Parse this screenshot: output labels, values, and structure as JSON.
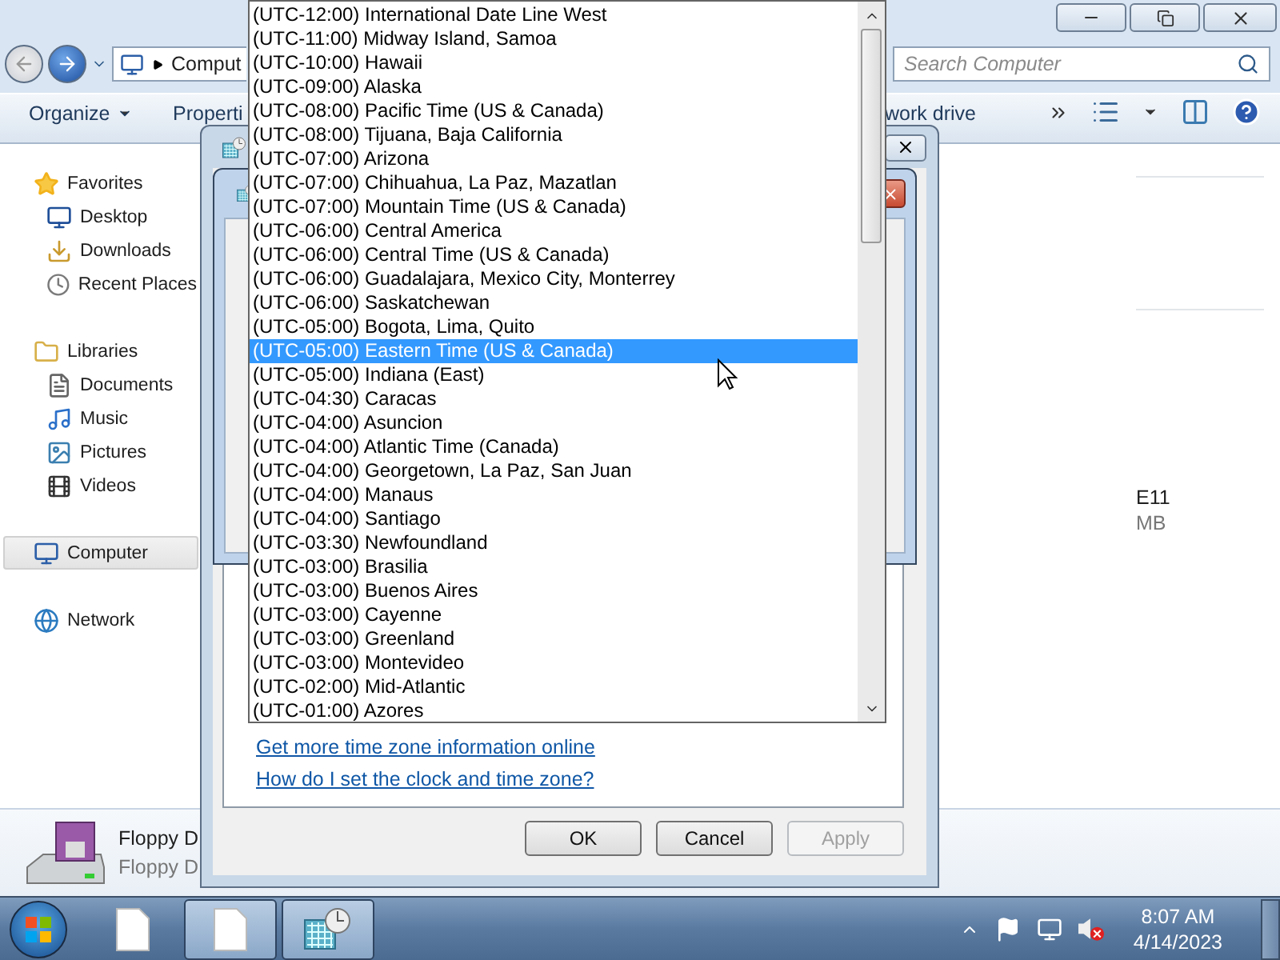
{
  "explorer": {
    "address": "Comput",
    "search": {
      "placeholder": "Search Computer"
    },
    "toolbar": [
      {
        "label": "Organize",
        "kind": "menu"
      },
      {
        "label": "Properti",
        "kind": "plain"
      },
      {
        "label": "work drive",
        "kind": "plain"
      }
    ],
    "sidebar": [
      {
        "label": "Favorites",
        "selected": false,
        "children": [
          {
            "label": "Desktop",
            "selected": false
          },
          {
            "label": "Downloads",
            "selected": false
          },
          {
            "label": "Recent Places",
            "selected": false
          }
        ]
      },
      {
        "label": "Libraries",
        "selected": false,
        "children": [
          {
            "label": "Documents",
            "selected": false
          },
          {
            "label": "Music",
            "selected": false
          },
          {
            "label": "Pictures",
            "selected": false
          },
          {
            "label": "Videos",
            "selected": false
          }
        ]
      },
      {
        "label": "Computer",
        "selected": true
      },
      {
        "label": "Network",
        "selected": false
      }
    ],
    "drive": {
      "name": "E11",
      "size": "MB"
    },
    "details": {
      "name": "Floppy D",
      "type": "Floppy D"
    }
  },
  "dialog": {
    "links": [
      "Get more time zone information online",
      "How do I set the clock and time zone?"
    ],
    "buttons": [
      {
        "label": "OK",
        "disabled": false
      },
      {
        "label": "Cancel",
        "disabled": false
      },
      {
        "label": "Apply",
        "disabled": true
      }
    ]
  },
  "timezones": [
    {
      "label": "(UTC-12:00) International Date Line West",
      "selected": false
    },
    {
      "label": "(UTC-11:00) Midway Island, Samoa",
      "selected": false
    },
    {
      "label": "(UTC-10:00) Hawaii",
      "selected": false
    },
    {
      "label": "(UTC-09:00) Alaska",
      "selected": false
    },
    {
      "label": "(UTC-08:00) Pacific Time (US & Canada)",
      "selected": false
    },
    {
      "label": "(UTC-08:00) Tijuana, Baja California",
      "selected": false
    },
    {
      "label": "(UTC-07:00) Arizona",
      "selected": false
    },
    {
      "label": "(UTC-07:00) Chihuahua, La Paz, Mazatlan",
      "selected": false
    },
    {
      "label": "(UTC-07:00) Mountain Time (US & Canada)",
      "selected": false
    },
    {
      "label": "(UTC-06:00) Central America",
      "selected": false
    },
    {
      "label": "(UTC-06:00) Central Time (US & Canada)",
      "selected": false
    },
    {
      "label": "(UTC-06:00) Guadalajara, Mexico City, Monterrey",
      "selected": false
    },
    {
      "label": "(UTC-06:00) Saskatchewan",
      "selected": false
    },
    {
      "label": "(UTC-05:00) Bogota, Lima, Quito",
      "selected": false
    },
    {
      "label": "(UTC-05:00) Eastern Time (US & Canada)",
      "selected": true
    },
    {
      "label": "(UTC-05:00) Indiana (East)",
      "selected": false
    },
    {
      "label": "(UTC-04:30) Caracas",
      "selected": false
    },
    {
      "label": "(UTC-04:00) Asuncion",
      "selected": false
    },
    {
      "label": "(UTC-04:00) Atlantic Time (Canada)",
      "selected": false
    },
    {
      "label": "(UTC-04:00) Georgetown, La Paz, San Juan",
      "selected": false
    },
    {
      "label": "(UTC-04:00) Manaus",
      "selected": false
    },
    {
      "label": "(UTC-04:00) Santiago",
      "selected": false
    },
    {
      "label": "(UTC-03:30) Newfoundland",
      "selected": false
    },
    {
      "label": "(UTC-03:00) Brasilia",
      "selected": false
    },
    {
      "label": "(UTC-03:00) Buenos Aires",
      "selected": false
    },
    {
      "label": "(UTC-03:00) Cayenne",
      "selected": false
    },
    {
      "label": "(UTC-03:00) Greenland",
      "selected": false
    },
    {
      "label": "(UTC-03:00) Montevideo",
      "selected": false
    },
    {
      "label": "(UTC-02:00) Mid-Atlantic",
      "selected": false
    },
    {
      "label": "(UTC-01:00) Azores",
      "selected": false
    }
  ],
  "taskbar": {
    "tasks": [
      {
        "kind": "document",
        "active": false
      },
      {
        "kind": "document",
        "active": true
      },
      {
        "kind": "calendar",
        "active": true
      }
    ],
    "time": "8:07 AM",
    "date": "4/14/2023"
  }
}
